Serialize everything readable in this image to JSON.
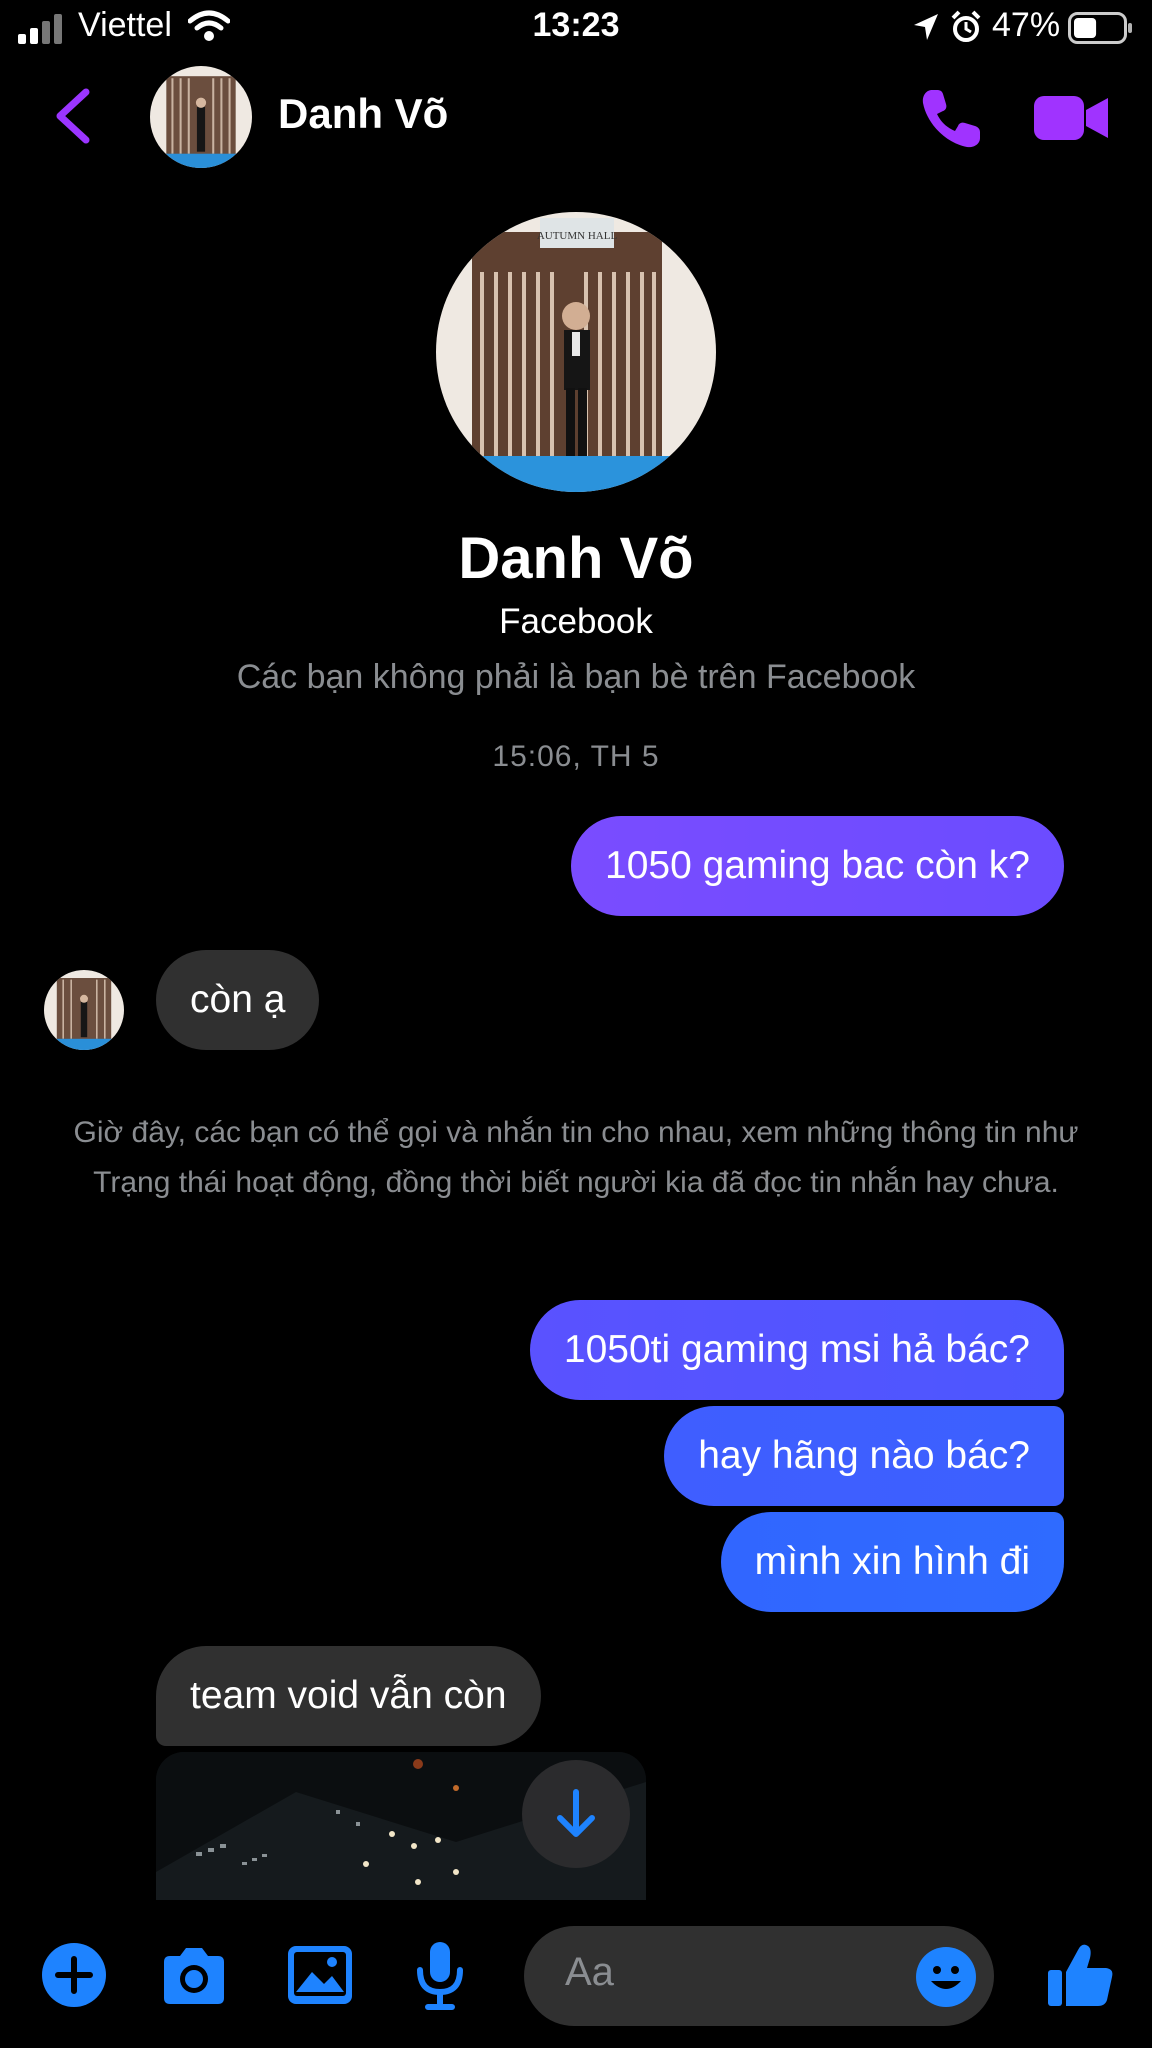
{
  "status_bar": {
    "carrier": "Viettel",
    "time": "13:23",
    "battery": "47%",
    "battery_level": 0.47
  },
  "header": {
    "name": "Danh Võ",
    "icons": [
      "back-chevron-icon",
      "phone-icon",
      "video-camera-icon"
    ],
    "accent_color": "#a033ff"
  },
  "profile": {
    "name": "Danh Võ",
    "platform": "Facebook",
    "relationship": "Các bạn không phải là bạn bè trên Facebook",
    "avatar_sign": "AUTUMN HALL"
  },
  "thread": {
    "timestamp": "15:06, TH 5",
    "messages": [
      {
        "from": "me",
        "text": "1050 gaming bac còn k?"
      },
      {
        "from": "them",
        "text": "còn ạ"
      },
      {
        "from": "me",
        "text": "1050ti gaming msi hả bác?"
      },
      {
        "from": "me",
        "text": "hay hãng nào bác?"
      },
      {
        "from": "me",
        "text": "mình xin hình đi"
      },
      {
        "from": "them",
        "text": "team void vẫn còn"
      }
    ],
    "system_notice": "Giờ đây, các bạn có thể gọi và nhắn tin cho nhau, xem những thông tin như Trạng thái hoạt động, đồng thời biết người kia đã đọc tin nhắn hay chưa.",
    "outgoing_gradient": [
      "#7a4cff",
      "#2f6bff"
    ]
  },
  "composer": {
    "placeholder": "Aa",
    "icons": [
      "plus-icon",
      "camera-icon",
      "image-icon",
      "microphone-icon",
      "emoji-icon",
      "thumbs-up-icon"
    ],
    "accent_color": "#1e83ff"
  }
}
